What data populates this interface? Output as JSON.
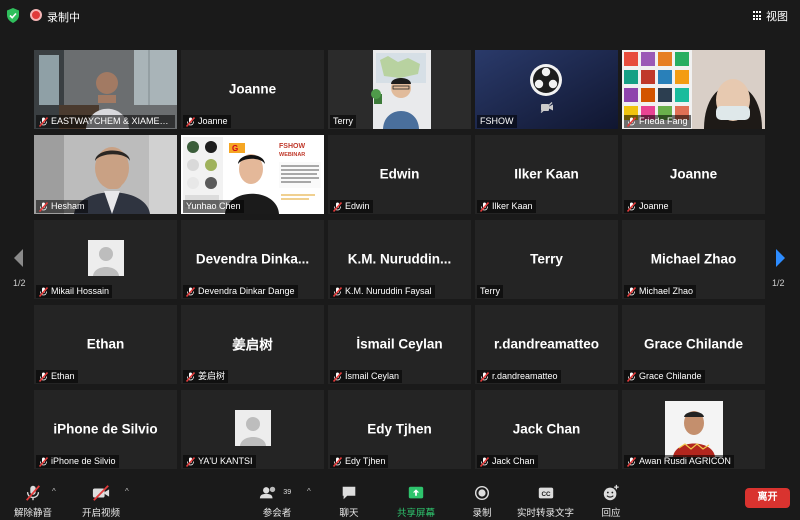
{
  "topbar": {
    "recording_label": "录制中",
    "view_label": "视图"
  },
  "pagination": {
    "left": "1/2",
    "right": "1/2"
  },
  "tiles": [
    {
      "name": "EASTWAYCHEM & XIAMEN ...",
      "label": "EASTWAYCHEM & XIAMEN ...",
      "muted": true,
      "kind": "video",
      "scene": "office"
    },
    {
      "name": "Joanne",
      "label": "Joanne",
      "muted": true,
      "kind": "name"
    },
    {
      "name": "Terry",
      "label": "Terry",
      "muted": false,
      "kind": "video",
      "scene": "terry",
      "active": true
    },
    {
      "name": "FSHOW",
      "label": "FSHOW",
      "muted": false,
      "kind": "video",
      "scene": "obs"
    },
    {
      "name": "Frieda Fang",
      "label": "Frieda Fang",
      "muted": true,
      "kind": "video",
      "scene": "frieda"
    },
    {
      "name": "Hesham",
      "label": "Hesham",
      "muted": true,
      "kind": "video",
      "scene": "hesham"
    },
    {
      "name": "Yunhao Chen",
      "label": "Yunhao Chen",
      "muted": false,
      "kind": "video",
      "scene": "webinar"
    },
    {
      "name": "Edwin",
      "label": "Edwin",
      "muted": true,
      "kind": "name"
    },
    {
      "name": "Ilker Kaan",
      "label": "Ilker Kaan",
      "muted": true,
      "kind": "name"
    },
    {
      "name": "Joanne",
      "label": "Joanne",
      "muted": true,
      "kind": "name"
    },
    {
      "name": "Mikail Hossain",
      "label": "Mikail Hossain",
      "muted": true,
      "kind": "avatar"
    },
    {
      "name": "Devendra Dinka...",
      "label": "Devendra Dinkar Dange",
      "muted": true,
      "kind": "name"
    },
    {
      "name": "K.M. Nuruddin...",
      "label": "K.M. Nuruddin Faysal",
      "muted": true,
      "kind": "name"
    },
    {
      "name": "Terry",
      "label": "Terry",
      "muted": false,
      "kind": "name"
    },
    {
      "name": "Michael Zhao",
      "label": "Michael Zhao",
      "muted": true,
      "kind": "name"
    },
    {
      "name": "Ethan",
      "label": "Ethan",
      "muted": true,
      "kind": "name"
    },
    {
      "name": "姜启树",
      "label": "姜启树",
      "muted": true,
      "kind": "name"
    },
    {
      "name": "İsmail Ceylan",
      "label": "İsmail Ceylan",
      "muted": true,
      "kind": "name"
    },
    {
      "name": "r.dandreamatteo",
      "label": "r.dandreamatteo",
      "muted": true,
      "kind": "name"
    },
    {
      "name": "Grace Chilande",
      "label": "Grace Chilande",
      "muted": true,
      "kind": "name"
    },
    {
      "name": "iPhone de Silvio",
      "label": "iPhone de Silvio",
      "muted": true,
      "kind": "name"
    },
    {
      "name": "YA'U KANTSI",
      "label": "YA'U KANTSI",
      "muted": true,
      "kind": "avatar"
    },
    {
      "name": "Edy Tjhen",
      "label": "Edy Tjhen",
      "muted": true,
      "kind": "name"
    },
    {
      "name": "Jack Chan",
      "label": "Jack Chan",
      "muted": true,
      "kind": "name"
    },
    {
      "name": "Awan Rusdi AGRICON",
      "label": "Awan Rusdi AGRICON",
      "muted": true,
      "kind": "photo"
    }
  ],
  "webinar": {
    "brand_left": "G",
    "brand_right": "FSHOW",
    "subtitle": "WEBINAR",
    "body": "The professional manufacturer of special fertilizers in China and Turkey"
  },
  "toolbar": {
    "unmute": "解除静音",
    "start_video": "开启视频",
    "participants": "参会者",
    "participants_count": "39",
    "chat": "聊天",
    "share": "共享屏幕",
    "record": "录制",
    "captions": "实时转录文字",
    "cc": "CC",
    "reactions": "回应",
    "leave": "离开"
  },
  "colors": {
    "active_outline": "#c9e86b",
    "share_green": "#2ec46d",
    "leave_red": "#d9332f",
    "muted_red": "#e23b3b"
  }
}
